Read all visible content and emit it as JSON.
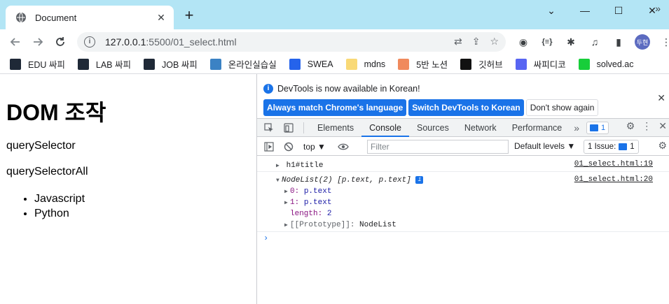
{
  "browser": {
    "tab_title": "Document",
    "tab_close": "✕",
    "new_tab": "+",
    "url_main": "127.0.0.1",
    "url_rest": ":5500/01_select.html",
    "profile": "두현",
    "win_minimize": "⌄",
    "win_min": "—",
    "win_max": "☐",
    "win_close": "✕"
  },
  "bookmarks": [
    {
      "label": "EDU 싸피",
      "icon": "ssafy-icon",
      "color": "#1f2937"
    },
    {
      "label": "LAB 싸피",
      "icon": "ssafy-icon",
      "color": "#1f2937"
    },
    {
      "label": "JOB 싸피",
      "icon": "ssafy-icon",
      "color": "#1f2937"
    },
    {
      "label": "온라인실습실",
      "icon": "ssafy-icon",
      "color": "#3b82c4"
    },
    {
      "label": "SWEA",
      "icon": "swea-icon",
      "color": "#2563eb"
    },
    {
      "label": "mdns",
      "icon": "folder-icon",
      "color": "#f9d976"
    },
    {
      "label": "5반 노션",
      "icon": "peach-icon",
      "color": "#f08a5d"
    },
    {
      "label": "깃허브",
      "icon": "github-icon",
      "color": "#111111"
    },
    {
      "label": "싸피디코",
      "icon": "discord-icon",
      "color": "#5865f2"
    },
    {
      "label": "solved.ac",
      "icon": "solvedac-icon",
      "color": "#17ce3a"
    }
  ],
  "page": {
    "heading": "DOM 조작",
    "p1": "querySelector",
    "p2": "querySelectorAll",
    "items": [
      "Javascript",
      "Python"
    ]
  },
  "devtools": {
    "notice_text": "DevTools is now available in Korean!",
    "btn_match": "Always match Chrome's language",
    "btn_switch": "Switch DevTools to Korean",
    "btn_dismiss": "Don't show again",
    "tabs": [
      "Elements",
      "Console",
      "Sources",
      "Network",
      "Performance"
    ],
    "active_tab": "Console",
    "tabs_more": "»",
    "msg_count": "1",
    "context": "top ▼",
    "filter_placeholder": "Filter",
    "levels": "Default levels ▼",
    "issues_label": "1 Issue:",
    "issues_count": "1"
  },
  "console": {
    "log1": {
      "text": "h1#title",
      "source": "01_select.html:19"
    },
    "log2": {
      "summary_head": "NodeList(2) [",
      "summary_items": "p.text, p.text",
      "summary_tail": "]",
      "source": "01_select.html:20",
      "entry0_key": "0",
      "entry0_val": "p.text",
      "entry1_key": "1",
      "entry1_val": "p.text",
      "length_key": "length",
      "length_val": "2",
      "proto": "[[Prototype]]",
      "proto_val": "NodeList"
    },
    "prompt": "›"
  }
}
